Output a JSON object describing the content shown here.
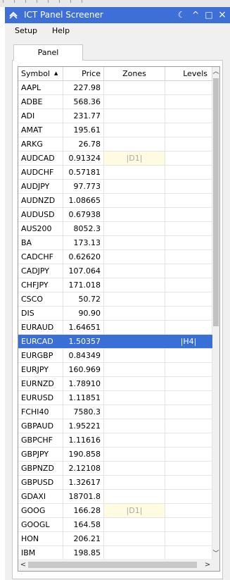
{
  "window": {
    "title": "ICT Panel Screener",
    "controls": {
      "theme": "☾",
      "collapse": "^",
      "restore": "□",
      "close": "×"
    }
  },
  "menu": [
    "Setup",
    "Help"
  ],
  "tab": "Panel",
  "table": {
    "columns": [
      "Symbol",
      "Price",
      "Zones",
      "Levels"
    ],
    "sorted_by": "Symbol",
    "rows": [
      {
        "symbol": "AAPL",
        "price": "227.98",
        "zones": "",
        "levels": ""
      },
      {
        "symbol": "ADBE",
        "price": "568.36",
        "zones": "",
        "levels": ""
      },
      {
        "symbol": "ADI",
        "price": "231.77",
        "zones": "",
        "levels": ""
      },
      {
        "symbol": "AMAT",
        "price": "195.61",
        "zones": "",
        "levels": ""
      },
      {
        "symbol": "ARKG",
        "price": "26.78",
        "zones": "",
        "levels": ""
      },
      {
        "symbol": "AUDCAD",
        "price": "0.91324",
        "zones": "|D1|",
        "levels": ""
      },
      {
        "symbol": "AUDCHF",
        "price": "0.57181",
        "zones": "",
        "levels": ""
      },
      {
        "symbol": "AUDJPY",
        "price": "97.773",
        "zones": "",
        "levels": ""
      },
      {
        "symbol": "AUDNZD",
        "price": "1.08665",
        "zones": "",
        "levels": ""
      },
      {
        "symbol": "AUDUSD",
        "price": "0.67938",
        "zones": "",
        "levels": ""
      },
      {
        "symbol": "AUS200",
        "price": "8052.3",
        "zones": "",
        "levels": ""
      },
      {
        "symbol": "BA",
        "price": "173.13",
        "zones": "",
        "levels": ""
      },
      {
        "symbol": "CADCHF",
        "price": "0.62620",
        "zones": "",
        "levels": ""
      },
      {
        "symbol": "CADJPY",
        "price": "107.064",
        "zones": "",
        "levels": ""
      },
      {
        "symbol": "CHFJPY",
        "price": "171.018",
        "zones": "",
        "levels": ""
      },
      {
        "symbol": "CSCO",
        "price": "50.72",
        "zones": "",
        "levels": ""
      },
      {
        "symbol": "DIS",
        "price": "90.90",
        "zones": "",
        "levels": ""
      },
      {
        "symbol": "EURAUD",
        "price": "1.64651",
        "zones": "",
        "levels": ""
      },
      {
        "symbol": "EURCAD",
        "price": "1.50357",
        "zones": "",
        "levels": "|H4|",
        "selected": true
      },
      {
        "symbol": "EURGBP",
        "price": "0.84349",
        "zones": "",
        "levels": ""
      },
      {
        "symbol": "EURJPY",
        "price": "160.969",
        "zones": "",
        "levels": ""
      },
      {
        "symbol": "EURNZD",
        "price": "1.78910",
        "zones": "",
        "levels": ""
      },
      {
        "symbol": "EURUSD",
        "price": "1.11851",
        "zones": "",
        "levels": ""
      },
      {
        "symbol": "FCHI40",
        "price": "7580.3",
        "zones": "",
        "levels": ""
      },
      {
        "symbol": "GBPAUD",
        "price": "1.95221",
        "zones": "",
        "levels": ""
      },
      {
        "symbol": "GBPCHF",
        "price": "1.11616",
        "zones": "",
        "levels": ""
      },
      {
        "symbol": "GBPJPY",
        "price": "190.858",
        "zones": "",
        "levels": ""
      },
      {
        "symbol": "GBPNZD",
        "price": "2.12108",
        "zones": "",
        "levels": ""
      },
      {
        "symbol": "GBPUSD",
        "price": "1.32617",
        "zones": "",
        "levels": ""
      },
      {
        "symbol": "GDAXI",
        "price": "18701.8",
        "zones": "",
        "levels": ""
      },
      {
        "symbol": "GOOG",
        "price": "166.28",
        "zones": "|D1|",
        "levels": ""
      },
      {
        "symbol": "GOOGL",
        "price": "164.58",
        "zones": "",
        "levels": ""
      },
      {
        "symbol": "HON",
        "price": "206.21",
        "zones": "",
        "levels": ""
      },
      {
        "symbol": "IBM",
        "price": "198.85",
        "zones": "",
        "levels": ""
      }
    ]
  },
  "colors": {
    "titlebar": "#3d6fd6",
    "selection": "#3a6fd8",
    "zone_highlight": "#fffbe0"
  }
}
